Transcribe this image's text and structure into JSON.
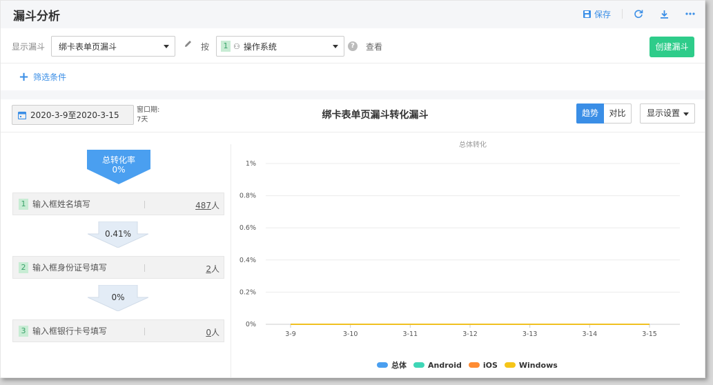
{
  "header": {
    "title": "漏斗分析",
    "save_label": "保存",
    "icons": [
      "save-icon",
      "refresh-icon",
      "download-icon",
      "more-icon"
    ]
  },
  "config": {
    "funnel_label": "显示漏斗",
    "funnel_select": "绑卡表单页漏斗",
    "by_label": "按",
    "dimension_num": "1",
    "dimension_select": "操作系统",
    "view_label": "查看",
    "create_button": "创建漏斗"
  },
  "filter": {
    "label": "筛选条件"
  },
  "toolbar": {
    "date_range": "2020-3-9至2020-3-15",
    "window_label": "窗口期:",
    "window_value": "7天",
    "funnel_title": "绑卡表单页漏斗转化漏斗",
    "trend_label": "趋势",
    "compare_label": "对比",
    "display_settings": "显示设置"
  },
  "funnel": {
    "total_label": "总转化率",
    "total_value": "0%",
    "steps": [
      {
        "num": "1",
        "name": "输入框姓名填写",
        "count": "487",
        "unit": "人"
      },
      {
        "num": "2",
        "name": "输入框身份证号填写",
        "count": "2",
        "unit": "人"
      },
      {
        "num": "3",
        "name": "输入框银行卡号填写",
        "count": "0",
        "unit": "人"
      }
    ],
    "rates": [
      "0.41%",
      "0%"
    ]
  },
  "chart_data": {
    "type": "line",
    "title": "总体转化",
    "categories": [
      "3-9",
      "3-10",
      "3-11",
      "3-12",
      "3-13",
      "3-14",
      "3-15"
    ],
    "yticks": [
      "0%",
      "0.2%",
      "0.4%",
      "0.6%",
      "0.8%",
      "1%"
    ],
    "ylim": [
      0,
      1
    ],
    "series": [
      {
        "name": "总体",
        "color": "#4a9ff0",
        "values": [
          0,
          0,
          0,
          0,
          0,
          0,
          0
        ]
      },
      {
        "name": "Android",
        "color": "#3fd6b6",
        "values": [
          0,
          0,
          0,
          0,
          0,
          0,
          0
        ]
      },
      {
        "name": "iOS",
        "color": "#ff8c33",
        "values": [
          0,
          0,
          0,
          0,
          0,
          0,
          0
        ]
      },
      {
        "name": "Windows",
        "color": "#f5c518",
        "values": [
          0,
          0,
          0,
          0,
          0,
          0,
          0
        ]
      }
    ],
    "grid": true,
    "legend": "bottom"
  }
}
